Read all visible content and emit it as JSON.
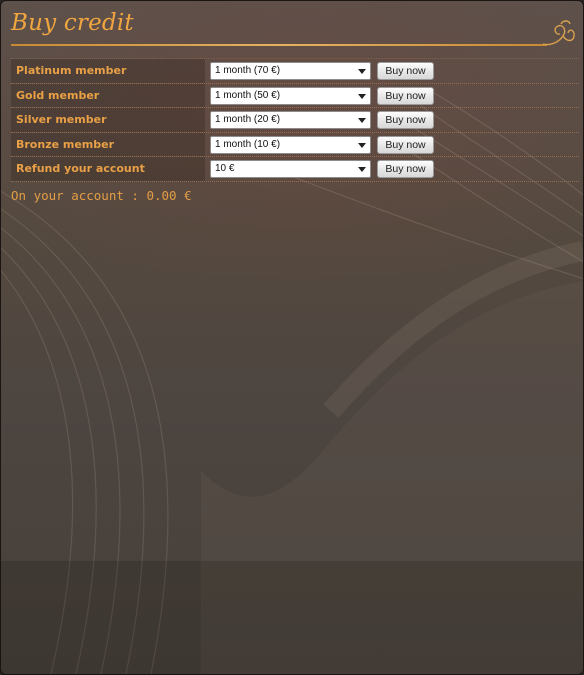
{
  "page": {
    "title": "Buy credit"
  },
  "offers": [
    {
      "label": "Platinum member",
      "selected": "1 month (70 €)",
      "button": "Buy now"
    },
    {
      "label": "Gold member",
      "selected": "1 month (50 €)",
      "button": "Buy now"
    },
    {
      "label": "Silver member",
      "selected": "1 month (20 €)",
      "button": "Buy now"
    },
    {
      "label": "Bronze member",
      "selected": "1 month (10 €)",
      "button": "Buy now"
    },
    {
      "label": "Refund your account",
      "selected": "10 €",
      "button": "Buy now"
    }
  ],
  "account": {
    "text": "On your account : 0.00 €"
  },
  "colors": {
    "accent": "#f0a640",
    "label": "#e9a046",
    "background": "#54493f"
  },
  "icons": {
    "ornament": "swirl-ornament-icon",
    "dropdown": "chevron-down-icon"
  }
}
